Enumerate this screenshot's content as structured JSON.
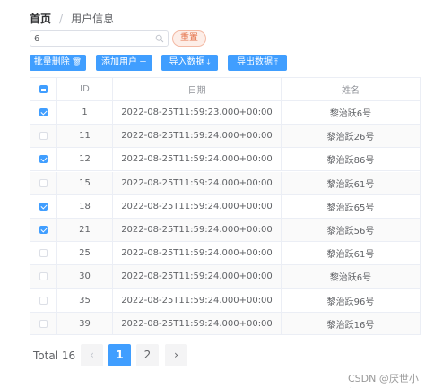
{
  "breadcrumb": {
    "home": "首页",
    "separator": "/",
    "current": "用户信息"
  },
  "search": {
    "value": "6",
    "placeholder": ""
  },
  "reset_label": "重置",
  "toolbar": {
    "batch_delete": "批量删除",
    "add_user": "添加用户",
    "import": "导入数据",
    "export": "导出数据"
  },
  "table": {
    "headers": {
      "id": "ID",
      "date": "日期",
      "name": "姓名"
    },
    "rows": [
      {
        "id": "1",
        "date": "2022-08-25T11:59:23.000+00:00",
        "name": "黎治跃6号",
        "checked": true
      },
      {
        "id": "11",
        "date": "2022-08-25T11:59:24.000+00:00",
        "name": "黎治跃26号",
        "checked": false
      },
      {
        "id": "12",
        "date": "2022-08-25T11:59:24.000+00:00",
        "name": "黎治跃86号",
        "checked": true
      },
      {
        "id": "15",
        "date": "2022-08-25T11:59:24.000+00:00",
        "name": "黎治跃61号",
        "checked": false
      },
      {
        "id": "18",
        "date": "2022-08-25T11:59:24.000+00:00",
        "name": "黎治跃65号",
        "checked": true
      },
      {
        "id": "21",
        "date": "2022-08-25T11:59:24.000+00:00",
        "name": "黎治跃56号",
        "checked": true
      },
      {
        "id": "25",
        "date": "2022-08-25T11:59:24.000+00:00",
        "name": "黎治跃61号",
        "checked": false
      },
      {
        "id": "30",
        "date": "2022-08-25T11:59:24.000+00:00",
        "name": "黎治跃6号",
        "checked": false
      },
      {
        "id": "35",
        "date": "2022-08-25T11:59:24.000+00:00",
        "name": "黎治跃96号",
        "checked": false
      },
      {
        "id": "39",
        "date": "2022-08-25T11:59:24.000+00:00",
        "name": "黎治跃16号",
        "checked": false
      }
    ]
  },
  "pagination": {
    "total": "Total 16",
    "prev": "‹",
    "next": "›",
    "pages": [
      "1",
      "2"
    ],
    "current": "1"
  },
  "watermark": "CSDN @厌世小耀曜",
  "colors": {
    "primary": "#409eff",
    "reset_text": "#e5744c",
    "reset_bg": "#fdeee8"
  }
}
